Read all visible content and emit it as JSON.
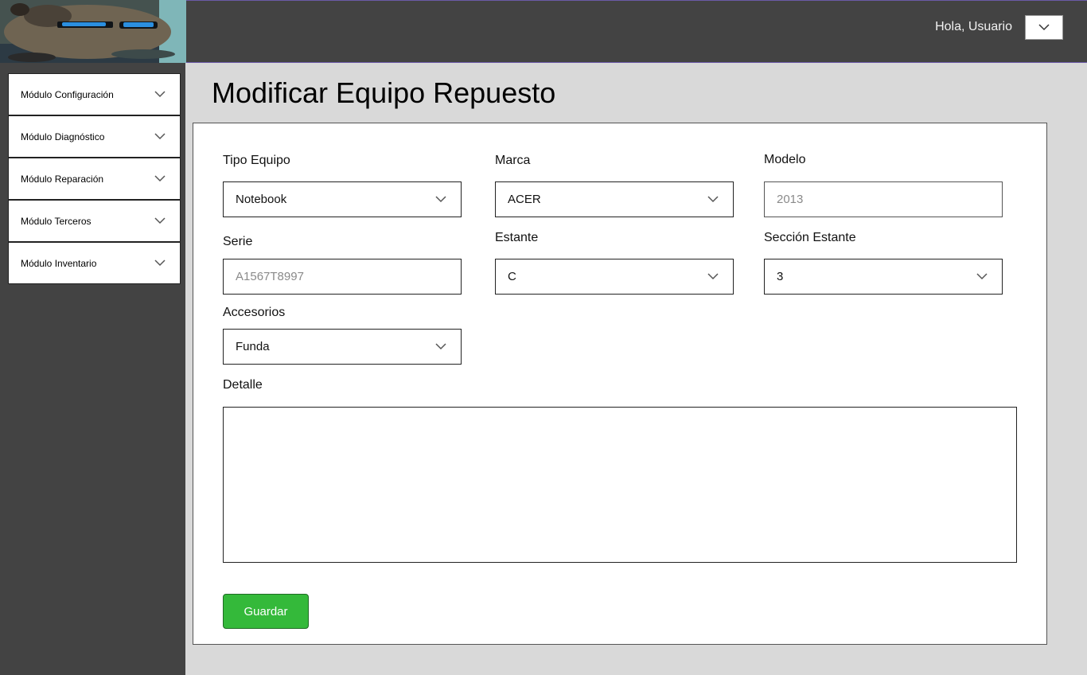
{
  "header": {
    "greeting": "Hola, Usuario",
    "user_menu_icon": "chevron-down-icon"
  },
  "sidebar": {
    "items": [
      {
        "label": "Módulo Configuración"
      },
      {
        "label": "Módulo Diagnóstico"
      },
      {
        "label": "Módulo Reparación"
      },
      {
        "label": "Módulo Terceros"
      },
      {
        "label": "Módulo Inventario"
      }
    ]
  },
  "page": {
    "title": "Modificar Equipo Repuesto"
  },
  "form": {
    "tipo_equipo": {
      "label": "Tipo Equipo",
      "value": "Notebook"
    },
    "marca": {
      "label": "Marca",
      "value": "ACER"
    },
    "modelo": {
      "label": "Modelo",
      "placeholder": "2013"
    },
    "serie": {
      "label": "Serie",
      "placeholder": "A1567T8997"
    },
    "estante": {
      "label": "Estante",
      "value": "C"
    },
    "seccion_estante": {
      "label": "Sección Estante",
      "value": "3"
    },
    "accesorios": {
      "label": "Accesorios",
      "value": "Funda"
    },
    "detalle": {
      "label": "Detalle"
    },
    "save_label": "Guardar"
  },
  "colors": {
    "topbar": "#434343",
    "sidebar": "#434343",
    "background": "#d9d9d9",
    "save_button": "#34b93a"
  }
}
